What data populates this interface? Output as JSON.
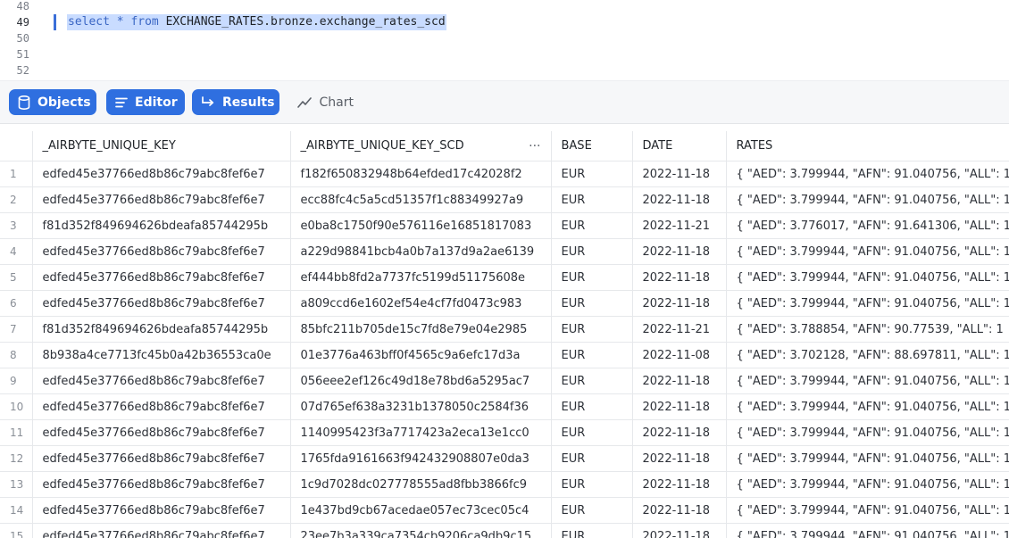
{
  "editor": {
    "lines": [
      {
        "num": "48",
        "text": "",
        "active": false
      },
      {
        "num": "49",
        "text": "select * from EXCHANGE_RATES.bronze.exchange_rates_scd",
        "active": true
      },
      {
        "num": "50",
        "text": "",
        "active": false
      },
      {
        "num": "51",
        "text": "",
        "active": false
      },
      {
        "num": "52",
        "text": "",
        "active": false
      }
    ],
    "query_parts": {
      "select": "select",
      "star": "*",
      "from": "from",
      "table": "EXCHANGE_RATES.bronze.exchange_rates_scd"
    }
  },
  "toolbar": {
    "objects_label": "Objects",
    "editor_label": "Editor",
    "results_label": "Results",
    "chart_label": "Chart",
    "accent": "#2f6fe0"
  },
  "grid": {
    "columns": [
      "",
      "_AIRBYTE_UNIQUE_KEY",
      "_AIRBYTE_UNIQUE_KEY_SCD",
      "BASE",
      "DATE",
      "RATES"
    ],
    "column_menu_glyph": "···",
    "rows": [
      [
        "1",
        "edfed45e37766ed8b86c79abc8fef6e7",
        "f182f650832948b64efded17c42028f2",
        "EUR",
        "2022-11-18",
        "{   \"AED\": 3.799944,   \"AFN\": 91.040756,   \"ALL\": 1"
      ],
      [
        "2",
        "edfed45e37766ed8b86c79abc8fef6e7",
        "ecc88fc4c5a5cd51357f1c88349927a9",
        "EUR",
        "2022-11-18",
        "{   \"AED\": 3.799944,   \"AFN\": 91.040756,   \"ALL\": 1"
      ],
      [
        "3",
        "f81d352f849694626bdeafa85744295b",
        "e0ba8c1750f90e576116e16851817083",
        "EUR",
        "2022-11-21",
        "{   \"AED\": 3.776017,   \"AFN\": 91.641306,   \"ALL\": 1"
      ],
      [
        "4",
        "edfed45e37766ed8b86c79abc8fef6e7",
        "a229d98841bcb4a0b7a137d9a2ae6139",
        "EUR",
        "2022-11-18",
        "{   \"AED\": 3.799944,   \"AFN\": 91.040756,   \"ALL\": 1"
      ],
      [
        "5",
        "edfed45e37766ed8b86c79abc8fef6e7",
        "ef444bb8fd2a7737fc5199d51175608e",
        "EUR",
        "2022-11-18",
        "{   \"AED\": 3.799944,   \"AFN\": 91.040756,   \"ALL\": 1"
      ],
      [
        "6",
        "edfed45e37766ed8b86c79abc8fef6e7",
        "a809ccd6e1602ef54e4cf7fd0473c983",
        "EUR",
        "2022-11-18",
        "{   \"AED\": 3.799944,   \"AFN\": 91.040756,   \"ALL\": 1"
      ],
      [
        "7",
        "f81d352f849694626bdeafa85744295b",
        "85bfc211b705de15c7fd8e79e04e2985",
        "EUR",
        "2022-11-21",
        "{   \"AED\": 3.788854,   \"AFN\": 90.77539,   \"ALL\": 1"
      ],
      [
        "8",
        "8b938a4ce7713fc45b0a42b36553ca0e",
        "01e3776a463bff0f4565c9a6efc17d3a",
        "EUR",
        "2022-11-08",
        "{   \"AED\": 3.702128,   \"AFN\": 88.697811,   \"ALL\": 1"
      ],
      [
        "9",
        "edfed45e37766ed8b86c79abc8fef6e7",
        "056eee2ef126c49d18e78bd6a5295ac7",
        "EUR",
        "2022-11-18",
        "{   \"AED\": 3.799944,   \"AFN\": 91.040756,   \"ALL\": 1"
      ],
      [
        "10",
        "edfed45e37766ed8b86c79abc8fef6e7",
        "07d765ef638a3231b1378050c2584f36",
        "EUR",
        "2022-11-18",
        "{   \"AED\": 3.799944,   \"AFN\": 91.040756,   \"ALL\": 1"
      ],
      [
        "11",
        "edfed45e37766ed8b86c79abc8fef6e7",
        "1140995423f3a7717423a2eca13e1cc0",
        "EUR",
        "2022-11-18",
        "{   \"AED\": 3.799944,   \"AFN\": 91.040756,   \"ALL\": 1"
      ],
      [
        "12",
        "edfed45e37766ed8b86c79abc8fef6e7",
        "1765fda9161663f942432908807e0da3",
        "EUR",
        "2022-11-18",
        "{   \"AED\": 3.799944,   \"AFN\": 91.040756,   \"ALL\": 1"
      ],
      [
        "13",
        "edfed45e37766ed8b86c79abc8fef6e7",
        "1c9d7028dc027778555ad8fbb3866fc9",
        "EUR",
        "2022-11-18",
        "{   \"AED\": 3.799944,   \"AFN\": 91.040756,   \"ALL\": 1"
      ],
      [
        "14",
        "edfed45e37766ed8b86c79abc8fef6e7",
        "1e437bd9cb67acedae057ec73cec05c4",
        "EUR",
        "2022-11-18",
        "{   \"AED\": 3.799944,   \"AFN\": 91.040756,   \"ALL\": 1"
      ],
      [
        "15",
        "edfed45e37766ed8b86c79abc8fef6e7",
        "23ee7b3a339ca7354cb9206ca9db9c15",
        "EUR",
        "2022-11-18",
        "{   \"AED\": 3.799944,   \"AFN\": 91.040756,   \"ALL\": 1"
      ]
    ]
  }
}
